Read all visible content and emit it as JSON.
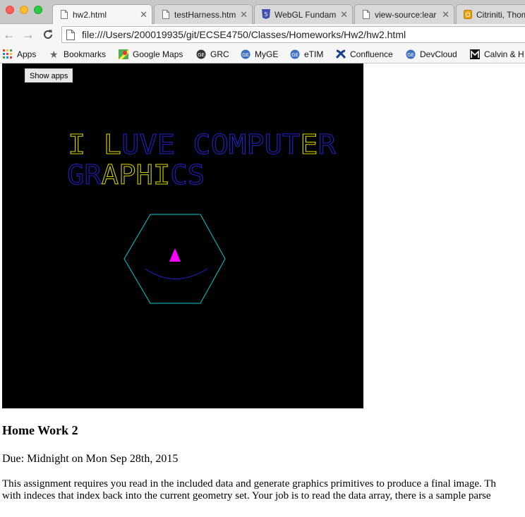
{
  "browser": {
    "tabs": [
      {
        "label": "hw2.html",
        "active": true
      },
      {
        "label": "testHarness.html",
        "active": false
      },
      {
        "label": "WebGL Fundame",
        "active": false
      },
      {
        "label": "view-source:lear",
        "active": false
      },
      {
        "label": "Citriniti, Thom",
        "active": false
      }
    ],
    "url": "file:///Users/200019935/git/ECSE4750/Classes/Homeworks/Hw2/hw2.html",
    "bookmarks": [
      {
        "label": "Apps",
        "icon": "apps-grid-icon"
      },
      {
        "label": "Bookmarks",
        "icon": "star-icon"
      },
      {
        "label": "Google Maps",
        "icon": "maps-icon"
      },
      {
        "label": "GRC",
        "icon": "ge-logo-icon"
      },
      {
        "label": "MyGE",
        "icon": "ge-logo-icon"
      },
      {
        "label": "eTIM",
        "icon": "ge-logo-icon"
      },
      {
        "label": "Confluence",
        "icon": "confluence-icon"
      },
      {
        "label": "DevCloud",
        "icon": "ge-logo-icon"
      },
      {
        "label": "Calvin & H",
        "icon": "calvin-icon"
      }
    ]
  },
  "canvas": {
    "show_apps_label": "Show apps",
    "line1_yellow": "I L",
    "line1_blue": "UVE COMPUT",
    "line1_yellow2": "E",
    "line1_blue2": "R",
    "line2_blue": "GR",
    "line2_yellow": "APHI",
    "line2_blue2": "CS",
    "colors": {
      "yellow": "#d8d800",
      "blue": "#2222cc",
      "cyan": "#00cccc",
      "magenta": "#ff00ff"
    }
  },
  "page": {
    "heading": "Home Work 2",
    "due": "Due: Midnight on Mon Sep 28th, 2015",
    "paragraph_line1": "This assignment requires you read in the included data and generate graphics primitives to produce a final image. Th",
    "paragraph_line2": "with indeces that index back into the current geometry set. Your job is to read the data array, there is a sample parse"
  }
}
